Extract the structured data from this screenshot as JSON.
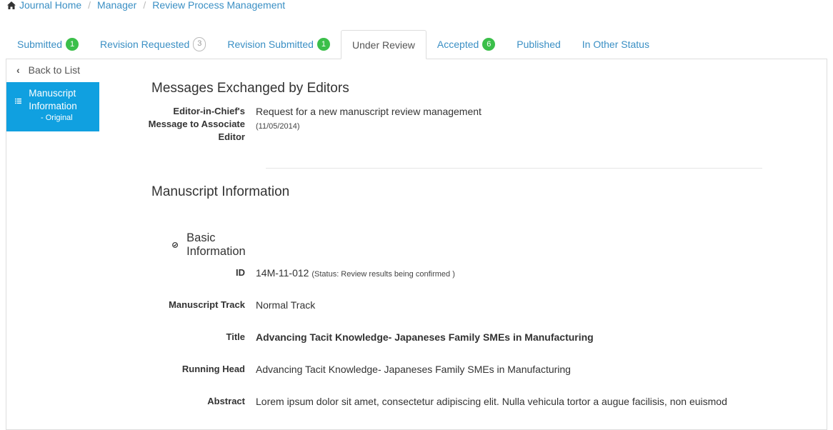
{
  "breadcrumb": {
    "items": [
      "Journal Home",
      "Manager",
      "Review Process Management"
    ]
  },
  "tabs": [
    {
      "label": "Submitted",
      "badge": "1"
    },
    {
      "label": "Revision Requested",
      "badge": "3"
    },
    {
      "label": "Revision Submitted",
      "badge": "1"
    },
    {
      "label": "Under Review",
      "badge": ""
    },
    {
      "label": "Accepted",
      "badge": "6"
    },
    {
      "label": "Published",
      "badge": ""
    },
    {
      "label": "In Other Status",
      "badge": ""
    }
  ],
  "sidebar": {
    "back_label": "Back to List",
    "active_item": {
      "label": "Manuscript Information",
      "sub": "- Original"
    }
  },
  "messages": {
    "heading": "Messages Exchanged by Editors",
    "label_lines": [
      "Editor-in-Chief's",
      "Message to Associate",
      "Editor"
    ],
    "text": "Request for a new manuscript review management",
    "date": "(11/05/2014)"
  },
  "manuscript": {
    "heading": "Manuscript Information",
    "section": "Basic Information",
    "id_label": "ID",
    "id_value": "14M-11-012",
    "id_status": "(Status: Review results being confirmed )",
    "track_label": "Manuscript Track",
    "track_value": "Normal Track",
    "title_label": "Title",
    "title_value": "Advancing Tacit Knowledge- Japaneses Family SMEs in Manufacturing",
    "running_label": "Running Head",
    "running_value": "Advancing Tacit Knowledge- Japaneses Family SMEs in Manufacturing",
    "abstract_label": "Abstract",
    "abstract_line1": "Lorem ipsum dolor sit amet, consectetur adipiscing elit. Nulla vehicula tortor a augue facilisis, non euismod"
  },
  "colors": {
    "link": "#3a8fc4",
    "badge_green": "#3bbf4a",
    "sidebar_active": "#10a0e0"
  }
}
